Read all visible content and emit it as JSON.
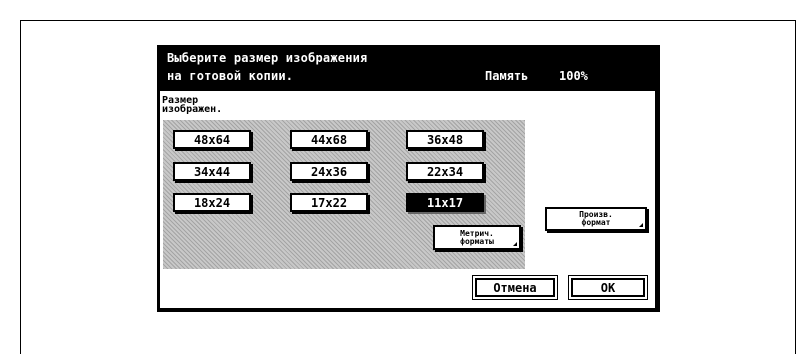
{
  "header": {
    "line1": "Выберите размер изображения",
    "line2": "на готовой копии.",
    "memory_label": "Память",
    "memory_value": "100%"
  },
  "section_label": "Размер\nизображен.",
  "sizes": [
    "48x64",
    "44x68",
    "36x48",
    "34x44",
    "24x36",
    "22x34",
    "18x24",
    "17x22",
    "11x17"
  ],
  "selected_size": "11x17",
  "metric_button": "Метрич.\nформаты",
  "custom_button": "Произв.\nформат",
  "cancel_button": "Отмена",
  "ok_button": "OK",
  "colors": {
    "panel": "#000000",
    "selected": "#000000",
    "background": "#ffffff"
  }
}
